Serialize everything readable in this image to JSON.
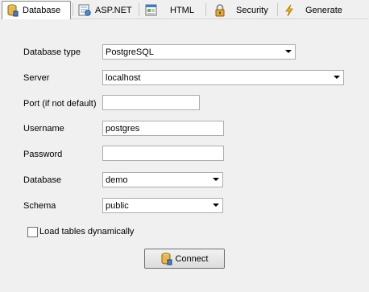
{
  "tabs": [
    {
      "label": "Database",
      "icon": "database-icon",
      "active": true
    },
    {
      "label": "ASP.NET",
      "icon": "aspnet-icon",
      "active": false
    },
    {
      "label": "HTML",
      "icon": "html-icon",
      "active": false
    },
    {
      "label": "Security",
      "icon": "lock-icon",
      "active": false
    },
    {
      "label": "Generate",
      "icon": "lightning-icon",
      "active": false
    }
  ],
  "form": {
    "database_type": {
      "label": "Database type",
      "value": "PostgreSQL"
    },
    "server": {
      "label": "Server",
      "value": "localhost"
    },
    "port": {
      "label": "Port (if not default)",
      "value": ""
    },
    "username": {
      "label": "Username",
      "value": "postgres"
    },
    "password": {
      "label": "Password",
      "value": ""
    },
    "database": {
      "label": "Database",
      "value": "demo"
    },
    "schema": {
      "label": "Schema",
      "value": "public"
    },
    "load_tables": {
      "label": "Load tables dynamically",
      "checked": false
    }
  },
  "connect_button": {
    "label": "Connect",
    "icon": "database-icon"
  },
  "colors": {
    "lightning": "#f5b800",
    "database_gold": "#e8b84a",
    "lock": "#c08a2a"
  }
}
